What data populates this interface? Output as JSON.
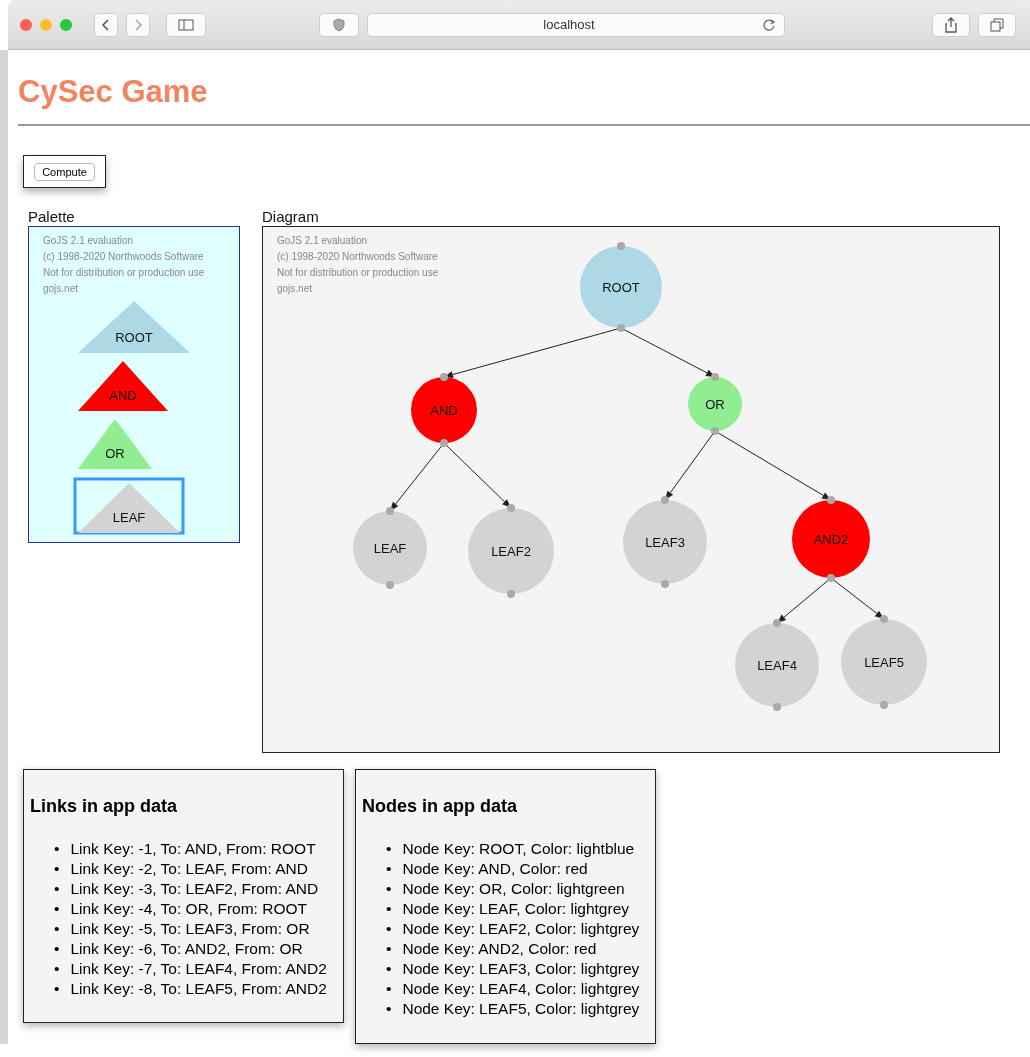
{
  "browser": {
    "url": "localhost"
  },
  "title": "CySec Game",
  "compute_button": "Compute",
  "palette": {
    "label": "Palette",
    "watermark": [
      "GoJS 2.1 evaluation",
      "(c) 1998-2020 Northwoods Software",
      "Not for distribution or production use",
      "gojs.net"
    ],
    "items": [
      {
        "label": "ROOT",
        "color": "#add8e6",
        "selected": false
      },
      {
        "label": "AND",
        "color": "#ff0000",
        "selected": false
      },
      {
        "label": "OR",
        "color": "#90ee90",
        "selected": false
      },
      {
        "label": "LEAF",
        "color": "#d3d3d3",
        "selected": true
      }
    ]
  },
  "diagram": {
    "label": "Diagram",
    "watermark": [
      "GoJS 2.1 evaluation",
      "(c) 1998-2020 Northwoods Software",
      "Not for distribution or production use",
      "gojs.net"
    ],
    "tree": {
      "label": "ROOT",
      "color": "#add8e6",
      "children": [
        {
          "label": "AND",
          "color": "#ff0000",
          "children": [
            {
              "label": "LEAF",
              "color": "#d3d3d3"
            },
            {
              "label": "LEAF2",
              "color": "#d3d3d3"
            }
          ]
        },
        {
          "label": "OR",
          "color": "#90ee90",
          "children": [
            {
              "label": "LEAF3",
              "color": "#d3d3d3"
            },
            {
              "label": "AND2",
              "color": "#ff0000",
              "children": [
                {
                  "label": "LEAF4",
                  "color": "#d3d3d3"
                },
                {
                  "label": "LEAF5",
                  "color": "#d3d3d3"
                }
              ]
            }
          ]
        }
      ]
    }
  },
  "links_panel": {
    "title": "Links in app data",
    "marker": "•",
    "items": [
      "Link Key: -1, To: AND, From: ROOT",
      "Link Key: -2, To: LEAF, From: AND",
      "Link Key: -3, To: LEAF2, From: AND",
      "Link Key: -4, To: OR, From: ROOT",
      "Link Key: -5, To: LEAF3, From: OR",
      "Link Key: -6, To: AND2, From: OR",
      "Link Key: -7, To: LEAF4, From: AND2",
      "Link Key: -8, To: LEAF5, From: AND2"
    ]
  },
  "nodes_panel": {
    "title": "Nodes in app data",
    "marker": "•",
    "items": [
      "Node Key: ROOT, Color: lightblue",
      "Node Key: AND, Color: red",
      "Node Key: OR, Color: lightgreen",
      "Node Key: LEAF, Color: lightgrey",
      "Node Key: LEAF2, Color: lightgrey",
      "Node Key: AND2, Color: red",
      "Node Key: LEAF3, Color: lightgrey",
      "Node Key: LEAF4, Color: lightgrey",
      "Node Key: LEAF5, Color: lightgrey"
    ]
  }
}
